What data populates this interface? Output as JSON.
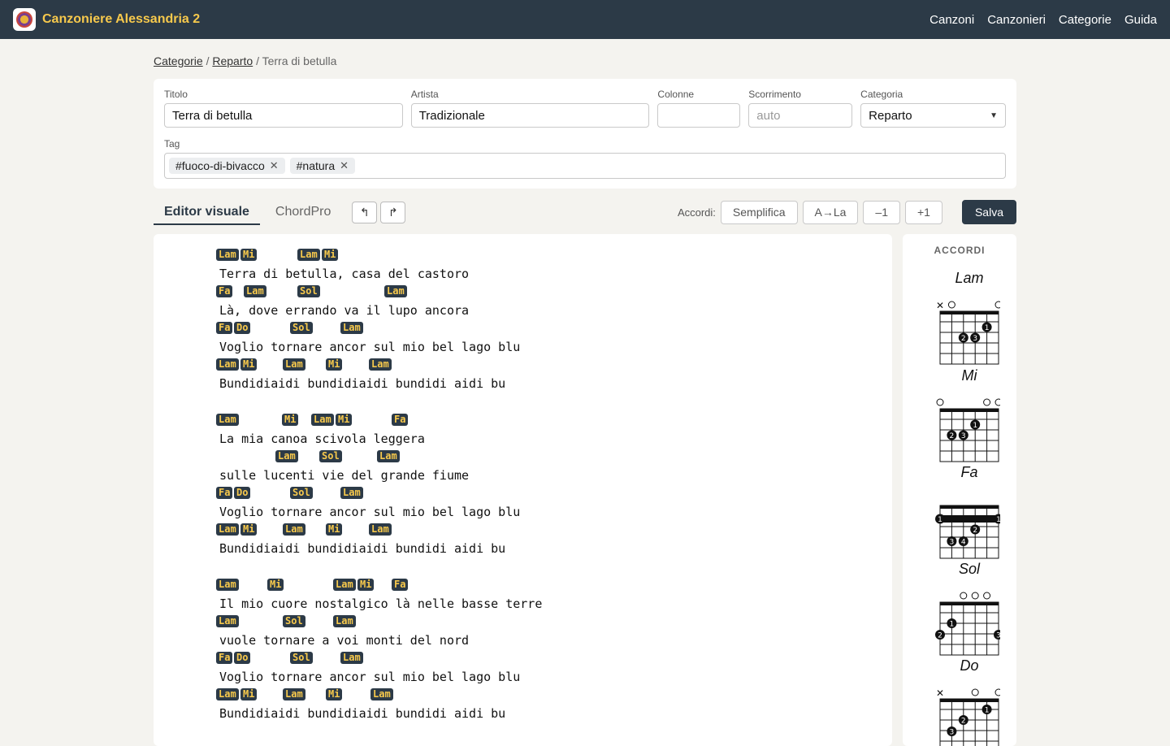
{
  "app": {
    "title": "Canzoniere Alessandria 2"
  },
  "nav": {
    "items": [
      "Canzoni",
      "Canzonieri",
      "Categorie",
      "Guida"
    ]
  },
  "breadcrumb": {
    "link1": "Categorie",
    "sep1": "/",
    "link2": "Reparto",
    "sep2": "/",
    "current": "Terra di betulla"
  },
  "form": {
    "titolo_label": "Titolo",
    "titolo_value": "Terra di betulla",
    "artista_label": "Artista",
    "artista_value": "Tradizionale",
    "colonne_label": "Colonne",
    "colonne_value": "",
    "scorrimento_label": "Scorrimento",
    "scorrimento_placeholder": "auto",
    "categoria_label": "Categoria",
    "categoria_value": "Reparto",
    "tag_label": "Tag",
    "tags": [
      "#fuoco-di-bivacco",
      "#natura"
    ]
  },
  "toolbar": {
    "tab_visual": "Editor visuale",
    "tab_chordpro": "ChordPro",
    "undo_icon": "↰",
    "redo_icon": "↱",
    "accordi_label": "Accordi:",
    "semplifica": "Semplifica",
    "a_la": "A→La",
    "minus1": "–1",
    "plus1": "+1",
    "save": "Salva"
  },
  "sidebar": {
    "title": "ACCORDI",
    "diagram_names": [
      "Lam",
      "Mi",
      "Fa",
      "Sol",
      "Do"
    ]
  },
  "song": {
    "lines": [
      {
        "chords": [
          [
            "Lam",
            0
          ],
          [
            "Mi",
            30
          ],
          [
            "Lam",
            100
          ],
          [
            "Mi",
            130
          ]
        ],
        "text": "Terra di betulla, casa del castoro"
      },
      {
        "chords": [
          [
            "Fa",
            0
          ],
          [
            "Lam",
            34
          ],
          [
            "Sol",
            100
          ],
          [
            "Lam",
            207
          ]
        ],
        "text": "Là, dove errando va il lupo ancora"
      },
      {
        "chords": [
          [
            "Fa",
            0
          ],
          [
            "Do",
            22
          ],
          [
            "Sol",
            91
          ],
          [
            "Lam",
            153
          ]
        ],
        "text": "Voglio tornare ancor sul mio bel lago blu"
      },
      {
        "chords": [
          [
            "Lam",
            0
          ],
          [
            "Mi",
            30
          ],
          [
            "Lam",
            82
          ],
          [
            "Mi",
            135
          ],
          [
            "Lam",
            188
          ]
        ],
        "text": "Bundidiaidi bundidiaidi bundidi aidi bu"
      },
      {
        "gap": true
      },
      {
        "chords": [
          [
            "Lam",
            0
          ],
          [
            "Mi",
            81
          ],
          [
            "Lam",
            117
          ],
          [
            "Mi",
            147
          ],
          [
            "Fa",
            216
          ]
        ],
        "text": "La mia canoa scivola leggera"
      },
      {
        "chords": [
          [
            "Lam",
            73
          ],
          [
            "Sol",
            127
          ],
          [
            "Lam",
            198
          ]
        ],
        "text": "sulle lucenti vie del grande fiume"
      },
      {
        "chords": [
          [
            "Fa",
            0
          ],
          [
            "Do",
            22
          ],
          [
            "Sol",
            91
          ],
          [
            "Lam",
            153
          ]
        ],
        "text": "Voglio tornare ancor sul mio bel lago blu"
      },
      {
        "chords": [
          [
            "Lam",
            0
          ],
          [
            "Mi",
            30
          ],
          [
            "Lam",
            82
          ],
          [
            "Mi",
            135
          ],
          [
            "Lam",
            188
          ]
        ],
        "text": "Bundidiaidi bundidiaidi bundidi aidi bu"
      },
      {
        "gap": true
      },
      {
        "chords": [
          [
            "Lam",
            0
          ],
          [
            "Mi",
            63
          ],
          [
            "Lam",
            144
          ],
          [
            "Mi",
            174
          ],
          [
            "Fa",
            216
          ]
        ],
        "text": "Il mio cuore nostalgico là nelle basse terre"
      },
      {
        "chords": [
          [
            "Lam",
            0
          ],
          [
            "Sol",
            82
          ],
          [
            "Lam",
            144
          ]
        ],
        "text": "vuole tornare a voi monti del nord"
      },
      {
        "chords": [
          [
            "Fa",
            0
          ],
          [
            "Do",
            22
          ],
          [
            "Sol",
            91
          ],
          [
            "Lam",
            153
          ]
        ],
        "text": "Voglio tornare ancor sul mio bel lago blu"
      },
      {
        "chords": [
          [
            "Lam",
            0
          ],
          [
            "Mi",
            30
          ],
          [
            "Lam",
            82
          ],
          [
            "Mi",
            135
          ],
          [
            "Lam",
            190
          ]
        ],
        "text": "Bundidiaidi bundidiaidi bundidi aidi bu"
      }
    ]
  }
}
